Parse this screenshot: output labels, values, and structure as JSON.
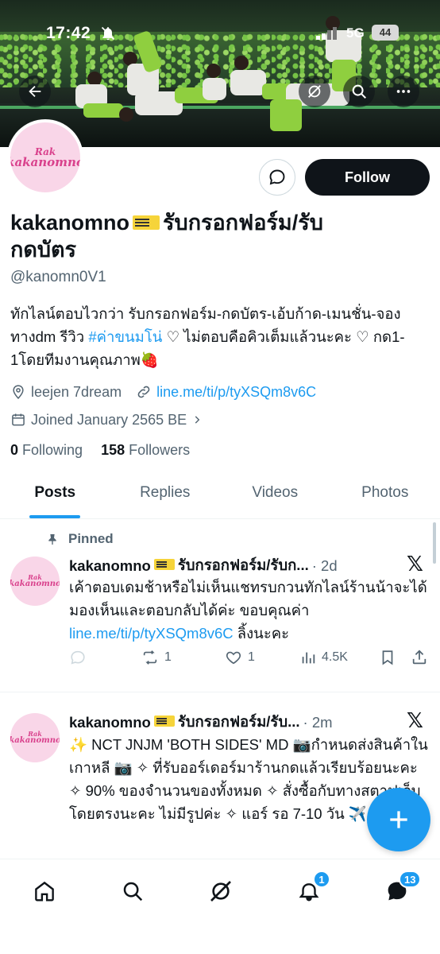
{
  "status_bar": {
    "time": "17:42",
    "network": "5G",
    "battery": "44"
  },
  "profile": {
    "name_line1": "kakanomno",
    "name_line1_suffix": "รับกรอกฟอร์ม/รับ",
    "name_line2": "กดบัตร",
    "handle": "@kanomn0V1",
    "bio_part1": "ทักไลน์ตอบไวกว่า รับกรอกฟอร์ม-กดบัตร-เอ้บก้าด-เมนชั่น-จองทางdm รีวิว ",
    "bio_hashtag": "#ค่าขนมโน่",
    "bio_part2": " ♡ ไม่ตอบคือคิวเต็มแล้วนะคะ ♡ กด1-1โดยทีมงานคุณภาพ",
    "bio_emoji": "🍓",
    "location": "leejen 7dream",
    "website": "line.me/ti/p/tyXSQm8v6C",
    "joined": "Joined January 2565 BE",
    "following_count": "0",
    "following_label": "Following",
    "followers_count": "158",
    "followers_label": "Followers",
    "follow_label": "Follow",
    "avatar_logo_line1": "Rak",
    "avatar_logo_line2": "kakanomno"
  },
  "tabs": [
    {
      "label": "Posts",
      "active": true
    },
    {
      "label": "Replies",
      "active": false
    },
    {
      "label": "Videos",
      "active": false
    },
    {
      "label": "Photos",
      "active": false
    }
  ],
  "posts": [
    {
      "pinned_label": "Pinned",
      "author": "kakanomno",
      "author_suffix": "รับกรอกฟอร์ม/รับก...",
      "time": "· 2d",
      "text_part1": "เค้าตอบเดมช้าหรือไม่เห็นแชทรบกวนทักไลน์ร้านน้าจะได้มองเห็นและตอบกลับได้ค่ะ ขอบคุณค่า ",
      "text_link": "line.me/ti/p/tyXSQm8v6C",
      "text_part2": " ลิ้งนะคะ",
      "retweets": "1",
      "likes": "1",
      "views": "4.5K"
    },
    {
      "author": "kakanomno",
      "author_suffix": "รับกรอกฟอร์ม/รับ...",
      "time": "· 2m",
      "text": "✨ NCT JNJM 'BOTH SIDES' MD 📷กำหนดส่งสินค้าในเกาหลี 📷 ✧ ที่รับออร์เดอร์มาร้านกดแล้วเรียบร้อยนะคะ ✧ 90% ของจำนวนของทั้งหมด ✧ สั่งซื้อกับทางสตาฟเว็บโดยตรงนะคะ ไม่มีรูปค่ะ ✧ แอร์ รอ 7-10 วัน ✈️"
    }
  ],
  "bottom_nav": {
    "notifications_badge": "1",
    "messages_badge": "13"
  },
  "colors": {
    "accent": "#1d9bf0",
    "text": "#0f1419",
    "muted": "#536471",
    "pink": "#d9418c"
  }
}
